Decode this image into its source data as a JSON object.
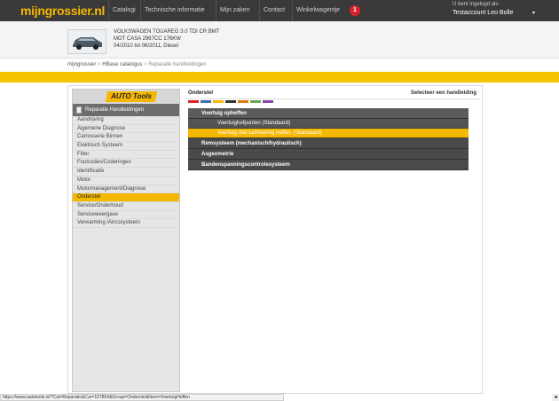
{
  "header": {
    "logo": "mijngrossier.nl",
    "nav": [
      "Catalogi",
      "Technische informatie",
      "Mijn zaken",
      "Contact",
      "Winkelwagentje"
    ],
    "cart_count": "1",
    "user_caption": "U bent ingelogd als:",
    "user_name": "Testaccount Leo Bolle"
  },
  "vehicle": {
    "line1": "VOLKSWAGEN TOUAREG 3.0 TDI CR BMT",
    "line2": "MOT CASA 2967CC 176KW",
    "line3": "04/2010 tot 06/2011, Diesel"
  },
  "breadcrumb": [
    "mijngrossier",
    "HBase catalogus",
    "Reparatie handleidingen"
  ],
  "sidebar": {
    "brand": "AUTO Tools",
    "header": "Reparatie Handleidingen",
    "items": [
      "Aandrijving",
      "Algemene Diagnose",
      "Carrosserie Binnen",
      "Elektrisch Systeem",
      "Filter",
      "Foutcodes/Coderingen",
      "Identificatie",
      "Motor",
      "Motormanagement/Diagnose",
      "Onderstel",
      "Service/Onderhoud",
      "Serviceweergave",
      "Verwarming /Aircosysteem"
    ],
    "active_index": 9
  },
  "main": {
    "title": "Onderstel",
    "select_label": "Selecteer een handleiding",
    "stripe_colors": [
      "#d9232a",
      "#3b6fb6",
      "#f5b800",
      "#333333",
      "#e07b00",
      "#6aa84f",
      "#8e44ad"
    ],
    "groups": [
      {
        "label": "Voertuig opheffen",
        "children": [
          "Voertuighefpunten (Standaard)",
          "Voertuig met luchtvering heffen. (Standaard)"
        ]
      },
      {
        "label": "Remsysteem (mechanisch/hydraulisch)"
      },
      {
        "label": "Asgeometrie"
      },
      {
        "label": "Bandenspanningscontrolesysteem"
      }
    ]
  },
  "status_url": "https://www.autotools.nl/?Cat=Reparatie&Car=167854&Group=Onderstel&Item=VoertuigHeffen"
}
